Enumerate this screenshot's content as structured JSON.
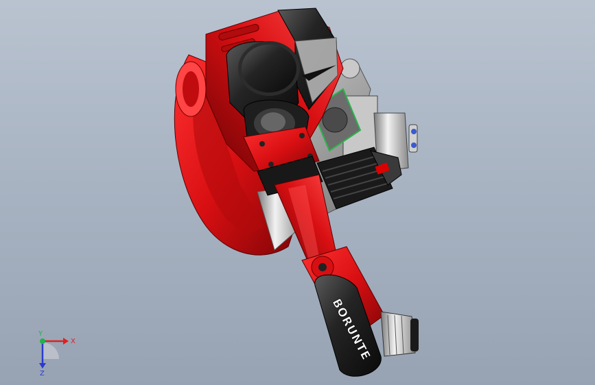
{
  "viewport": {
    "model": {
      "brand_text": "BORUNTE"
    }
  },
  "triad": {
    "x_label": "X",
    "y_label": "Y",
    "z_label": "Z",
    "colors": {
      "x": "#e02020",
      "y": "#22b14c",
      "z": "#2a3ad0"
    }
  },
  "colors": {
    "robot_red": "#d80f12",
    "robot_dark_red": "#8e0608",
    "robot_black": "#1c1c1c",
    "robot_grey": "#9a9a9a",
    "background_top": "#b9c3d0",
    "background_bottom": "#97a3b3"
  }
}
